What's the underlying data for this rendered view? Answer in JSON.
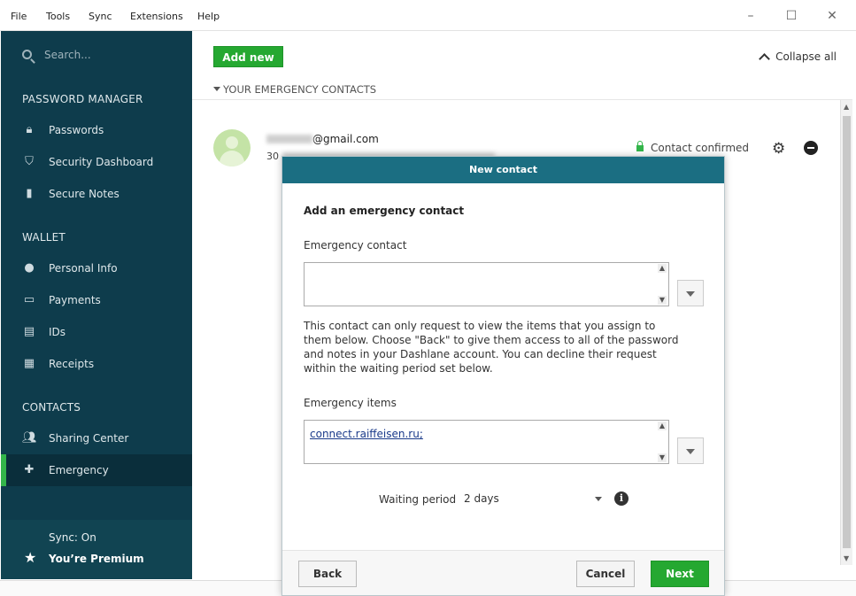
{
  "menubar": {
    "items": [
      "File",
      "Tools",
      "Sync",
      "Extensions",
      "Help"
    ]
  },
  "window_controls": {
    "minimize": "–",
    "maximize": "☐",
    "close": "✕"
  },
  "sidebar": {
    "search_placeholder": "Search...",
    "sections": {
      "password_manager": "PASSWORD MANAGER",
      "wallet": "WALLET",
      "contacts": "CONTACTS"
    },
    "items": [
      {
        "label": "Passwords",
        "icon": "lock-icon"
      },
      {
        "label": "Security Dashboard",
        "icon": "shield-icon"
      },
      {
        "label": "Secure Notes",
        "icon": "note-lock-icon"
      },
      {
        "label": "Personal Info",
        "icon": "person-icon"
      },
      {
        "label": "Payments",
        "icon": "card-icon"
      },
      {
        "label": "IDs",
        "icon": "id-card-icon"
      },
      {
        "label": "Receipts",
        "icon": "receipt-icon"
      },
      {
        "label": "Sharing Center",
        "icon": "people-icon"
      },
      {
        "label": "Emergency",
        "icon": "medkit-icon"
      }
    ],
    "active": "Emergency",
    "sync": "Sync: On",
    "premium": "You’re Premium"
  },
  "main": {
    "add_new": "Add new",
    "collapse_all": "Collapse all",
    "section_title": "YOUR EMERGENCY CONTACTS",
    "contact": {
      "email_domain": "@gmail.com",
      "subtitle_prefix": "30",
      "status": "Contact confirmed"
    }
  },
  "modal": {
    "header": "New contact",
    "title": "Add an emergency contact",
    "contact_label": "Emergency contact",
    "contact_value": "",
    "description": "This contact can only request to view the items that you assign to them below. Choose \"Back\" to give them access to all of the password and notes in your Dashlane account. You can decline their request within the waiting period set below.",
    "items_label": "Emergency items",
    "items_value": "connect.raiffeisen.ru;",
    "waiting_label": "Waiting period",
    "waiting_value": "2 days",
    "buttons": {
      "back": "Back",
      "cancel": "Cancel",
      "next": "Next"
    }
  },
  "colors": {
    "sidebar": "#0e3c4c",
    "accent": "#25a831",
    "modal_header": "#1b6e82"
  }
}
